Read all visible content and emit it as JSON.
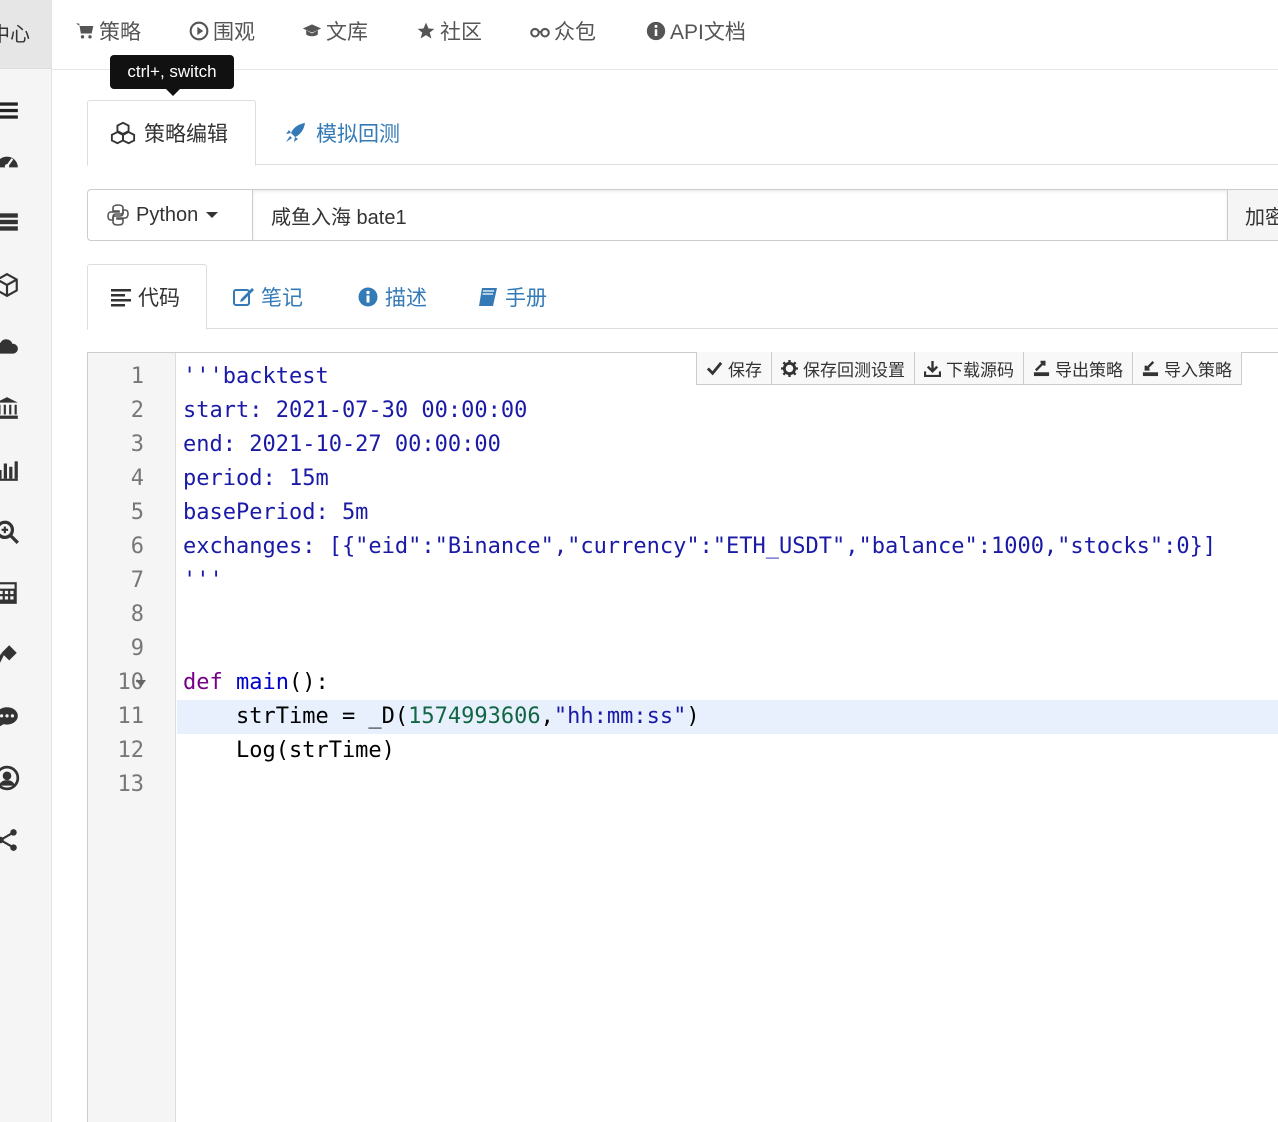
{
  "sidebar": {
    "header_text": "中心",
    "icons": [
      "menu-icon",
      "dashboard-icon",
      "server-icon",
      "cube-icon",
      "cloud-icon",
      "bank-icon",
      "bar-chart-icon",
      "zoom-in-icon",
      "calculator-icon",
      "plug-icon",
      "comment-icon",
      "user-circle-icon",
      "share-icon"
    ]
  },
  "topnav": {
    "items": [
      {
        "label": "策略",
        "icon": "cart-icon"
      },
      {
        "label": "围观",
        "icon": "play-circle-icon"
      },
      {
        "label": "文库",
        "icon": "graduation-cap-icon"
      },
      {
        "label": "社区",
        "icon": "star-icon"
      },
      {
        "label": "众包",
        "icon": "glasses-icon"
      },
      {
        "label": "API文档",
        "icon": "info-circle-icon"
      }
    ]
  },
  "tooltip": {
    "text": "ctrl+, switch"
  },
  "main_tabs": [
    {
      "label": "策略编辑",
      "icon": "cubes-icon",
      "active": true
    },
    {
      "label": "模拟回测",
      "icon": "rocket-icon",
      "active": false
    }
  ],
  "strategy": {
    "language": "Python",
    "name": "咸鱼入海 bate1",
    "encrypt_label": "加密"
  },
  "sub_tabs": [
    {
      "label": "代码",
      "icon": "align-left-icon",
      "active": true
    },
    {
      "label": "笔记",
      "icon": "edit-icon",
      "active": false
    },
    {
      "label": "描述",
      "icon": "info-circle-icon",
      "active": false
    },
    {
      "label": "手册",
      "icon": "book-icon",
      "active": false
    }
  ],
  "toolbar": {
    "save": "保存",
    "save_backtest": "保存回测设置",
    "download": "下载源码",
    "export": "导出策略",
    "import": "导入策略"
  },
  "editor": {
    "line_numbers": [
      "1",
      "2",
      "3",
      "4",
      "5",
      "6",
      "7",
      "8",
      "9",
      "10",
      "11",
      "12",
      "13"
    ],
    "active_line": 11,
    "lines": [
      [
        {
          "t": "str",
          "v": "'''backtest"
        }
      ],
      [
        {
          "t": "str",
          "v": "start: 2021-07-30 00:00:00"
        }
      ],
      [
        {
          "t": "str",
          "v": "end: 2021-10-27 00:00:00"
        }
      ],
      [
        {
          "t": "str",
          "v": "period: 15m"
        }
      ],
      [
        {
          "t": "str",
          "v": "basePeriod: 5m"
        }
      ],
      [
        {
          "t": "str",
          "v": "exchanges: [{\"eid\":\"Binance\",\"currency\":\"ETH_USDT\",\"balance\":1000,\"stocks\":0}]"
        }
      ],
      [
        {
          "t": "str",
          "v": "'''"
        }
      ],
      [],
      [],
      [
        {
          "t": "kw",
          "v": "def"
        },
        {
          "t": "plain",
          "v": " "
        },
        {
          "t": "fn",
          "v": "main"
        },
        {
          "t": "plain",
          "v": "():"
        }
      ],
      [
        {
          "t": "plain",
          "v": "    strTime = _D("
        },
        {
          "t": "num",
          "v": "1574993606"
        },
        {
          "t": "plain",
          "v": ","
        },
        {
          "t": "str",
          "v": "\"hh:mm:ss\""
        },
        {
          "t": "plain",
          "v": ")"
        }
      ],
      [
        {
          "t": "plain",
          "v": "    Log(strTime)"
        }
      ],
      []
    ]
  }
}
